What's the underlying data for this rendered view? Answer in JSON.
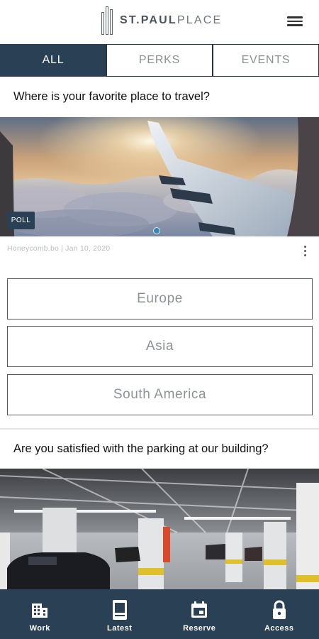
{
  "header": {
    "logo_bold": "ST.PAUL",
    "logo_light": "PLACE",
    "menu_icon": "hamburger-menu-icon"
  },
  "tabs": [
    {
      "label": "ALL",
      "active": true
    },
    {
      "label": "PERKS",
      "active": false
    },
    {
      "label": "EVENTS",
      "active": false
    }
  ],
  "posts": [
    {
      "title": "Where is your favorite place to travel?",
      "badge": "POLL",
      "meta": "Honeycomb.bo | Jan 10, 2020",
      "options": [
        "Europe",
        "Asia",
        "South America"
      ]
    },
    {
      "title": "Are you satisfied with the parking at our building?"
    }
  ],
  "bottom_nav": {
    "colors": {
      "background": "#2a4055",
      "accent": "#2a4055"
    },
    "items": [
      {
        "label": "Work",
        "icon": "building-icon"
      },
      {
        "label": "Latest",
        "icon": "news-icon"
      },
      {
        "label": "Reserve",
        "icon": "calendar-icon"
      },
      {
        "label": "Access",
        "icon": "lock-icon"
      }
    ]
  }
}
